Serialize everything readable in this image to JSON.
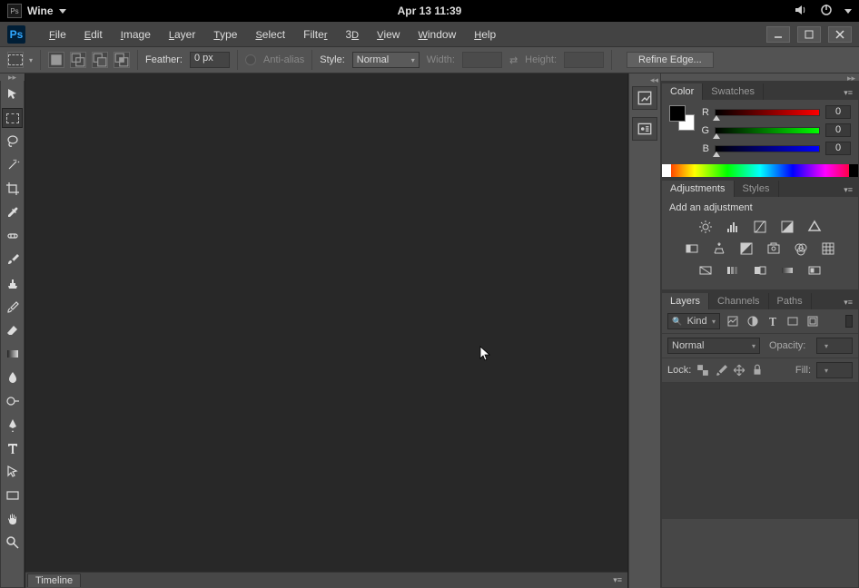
{
  "system": {
    "app_title": "Wine",
    "datetime": "Apr 13  11:39"
  },
  "menu": {
    "file": "File",
    "edit": "Edit",
    "image": "Image",
    "layer": "Layer",
    "type": "Type",
    "select": "Select",
    "filter": "Filter",
    "threeD": "3D",
    "view": "View",
    "window": "Window",
    "help": "Help"
  },
  "options": {
    "feather_label": "Feather:",
    "feather_value": "0 px",
    "antialias_label": "Anti-alias",
    "style_label": "Style:",
    "style_value": "Normal",
    "width_label": "Width:",
    "height_label": "Height:",
    "refine_label": "Refine Edge..."
  },
  "panels": {
    "color": {
      "tab_color": "Color",
      "tab_swatches": "Swatches",
      "r_label": "R",
      "g_label": "G",
      "b_label": "B",
      "r_val": "0",
      "g_val": "0",
      "b_val": "0"
    },
    "adjustments": {
      "tab_adj": "Adjustments",
      "tab_styles": "Styles",
      "hint": "Add an adjustment"
    },
    "layers": {
      "tab_layers": "Layers",
      "tab_channels": "Channels",
      "tab_paths": "Paths",
      "kind_label": "Kind",
      "blend_value": "Normal",
      "opacity_label": "Opacity:",
      "lock_label": "Lock:",
      "fill_label": "Fill:"
    }
  },
  "timeline": {
    "label": "Timeline"
  }
}
